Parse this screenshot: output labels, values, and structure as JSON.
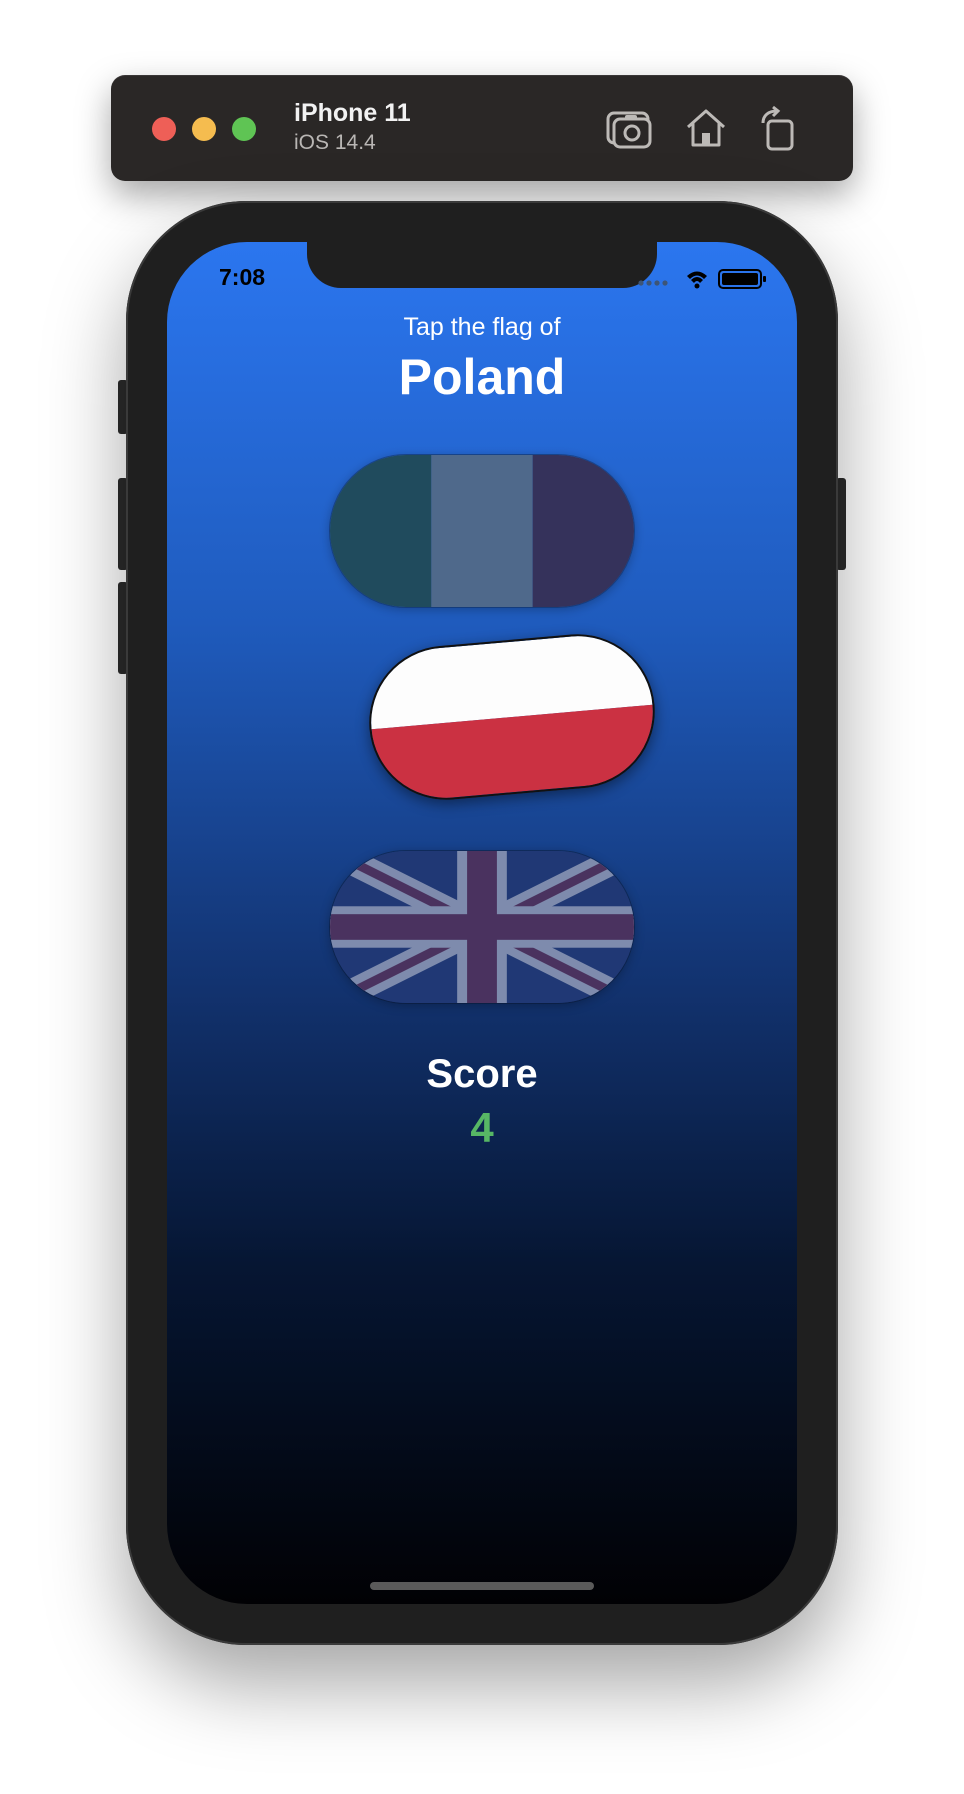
{
  "simulator": {
    "device_name": "iPhone 11",
    "os_version": "iOS 14.4",
    "toolbar_buttons": [
      "screenshot-icon",
      "home-icon",
      "rotate-icon"
    ]
  },
  "status_bar": {
    "time": "7:08",
    "icons": [
      "cellular-icon",
      "wifi-icon",
      "battery-icon"
    ]
  },
  "game": {
    "prompt": "Tap the flag of",
    "country": "Poland",
    "flags": [
      {
        "country_flag": "tricolor-vertical",
        "colors": [
          "#1f5a73",
          "#587cab",
          "#3e3a73"
        ],
        "dimmed": true
      },
      {
        "country_flag": "poland",
        "colors": [
          "#fdfdfd",
          "#cb3142"
        ],
        "dimmed": false
      },
      {
        "country_flag": "union-jack",
        "colors": [
          "#182e63",
          "#8d99b6",
          "#3d2f5f"
        ],
        "dimmed": true
      }
    ],
    "score_label": "Score",
    "score_value": "4"
  },
  "colors": {
    "background_top": "#2b76ef",
    "background_bottom": "#010104",
    "score_accent": "#57b765"
  }
}
